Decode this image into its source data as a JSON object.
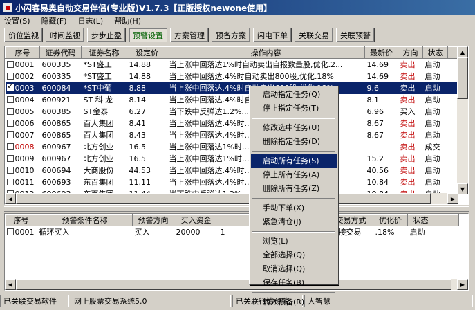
{
  "window": {
    "title": "小闪客易奥自动交易伴侣(专业版)V1.7.3【正版授权newone使用】"
  },
  "menu": [
    {
      "label": "设置(S)"
    },
    {
      "label": "隐藏(F)"
    },
    {
      "label": "日志(L)"
    },
    {
      "label": "帮助(H)"
    }
  ],
  "toolbar": [
    {
      "label": "价位监视"
    },
    {
      "label": "时间监视"
    },
    {
      "label": "步步止盈"
    },
    {
      "label": "预警设置",
      "active": true
    },
    {
      "label": "方案管理"
    },
    {
      "label": "预备方案"
    },
    {
      "label": "闪电下单"
    },
    {
      "label": "关联交易"
    },
    {
      "label": "关联预警"
    }
  ],
  "task_table": {
    "headers": [
      "序号",
      "证券代码",
      "证券名称",
      "设定价",
      "操作内容",
      "最新价",
      "方向",
      "状态"
    ],
    "rows": [
      {
        "no": "0001",
        "code": "600335",
        "name": "*ST盛工",
        "price": "14.88",
        "content": "当上涨中回落达1%时自动卖出自报数量股,优化.2...",
        "latest": "14.69",
        "dir": "卖出",
        "status": "启动",
        "checked": false,
        "selected": false,
        "no_red": false,
        "dir_red": true
      },
      {
        "no": "0002",
        "code": "600335",
        "name": "*ST盛工",
        "price": "14.88",
        "content": "当上涨中回落达.4%时自动卖出800股,优化.18%",
        "latest": "14.69",
        "dir": "卖出",
        "status": "启动",
        "checked": false,
        "selected": false,
        "no_red": false,
        "dir_red": true
      },
      {
        "no": "0003",
        "code": "600084",
        "name": "*ST中葡",
        "price": "8.88",
        "content": "当上涨中回落达.4%时自动卖出600股,优化.18%",
        "latest": "9.6",
        "dir": "卖出",
        "status": "启动",
        "checked": true,
        "selected": true,
        "no_red": false,
        "dir_red": true
      },
      {
        "no": "0004",
        "code": "600921",
        "name": "ST 科 龙",
        "price": "8.14",
        "content": "当上涨中回落达.4%时自动卖出...",
        "latest": "8.1",
        "dir": "卖出",
        "status": "启动",
        "checked": false,
        "selected": false,
        "no_red": false,
        "dir_red": true
      },
      {
        "no": "0005",
        "code": "600385",
        "name": "ST金泰",
        "price": "6.27",
        "content": "当下跌中反弹达1.2%...",
        "latest": "6.96",
        "dir": "买入",
        "status": "启动",
        "checked": false,
        "selected": false,
        "no_red": false,
        "dir_red": false
      },
      {
        "no": "0006",
        "code": "600865",
        "name": "百大集团",
        "price": "8.41",
        "content": "当上涨中回落达.4%时...",
        "latest": "8.67",
        "dir": "卖出",
        "status": "启动",
        "checked": false,
        "selected": false,
        "no_red": false,
        "dir_red": true
      },
      {
        "no": "0007",
        "code": "600865",
        "name": "百大集团",
        "price": "8.43",
        "content": "当上涨中回落达.4%时...",
        "latest": "8.67",
        "dir": "卖出",
        "status": "启动",
        "checked": false,
        "selected": false,
        "no_red": false,
        "dir_red": true
      },
      {
        "no": "0008",
        "code": "600967",
        "name": "北方创业",
        "price": "16.5",
        "content": "当上涨中回落达1%时...",
        "latest": "",
        "dir": "卖出",
        "status": "成交",
        "checked": false,
        "selected": false,
        "no_red": true,
        "dir_red": true
      },
      {
        "no": "0009",
        "code": "600967",
        "name": "北方创业",
        "price": "16.5",
        "content": "当上涨中回落达1%时...",
        "latest": "15.2",
        "dir": "卖出",
        "status": "启动",
        "checked": false,
        "selected": false,
        "no_red": false,
        "dir_red": true
      },
      {
        "no": "0010",
        "code": "600694",
        "name": "大商股份",
        "price": "44.53",
        "content": "当上涨中回落达.4%时...",
        "latest": "40.56",
        "dir": "卖出",
        "status": "启动",
        "checked": false,
        "selected": false,
        "no_red": false,
        "dir_red": true
      },
      {
        "no": "0011",
        "code": "600693",
        "name": "东百集团",
        "price": "11.11",
        "content": "当上涨中回落达.4%时...",
        "latest": "10.84",
        "dir": "卖出",
        "status": "启动",
        "checked": false,
        "selected": false,
        "no_red": false,
        "dir_red": true
      },
      {
        "no": "0012",
        "code": "600693",
        "name": "东百集团",
        "price": "11.44",
        "content": "当下跌中反弹达1.2%...",
        "latest": "10.84",
        "dir": "卖出",
        "status": "启动",
        "checked": false,
        "selected": false,
        "no_red": false,
        "dir_red": true
      }
    ]
  },
  "alert_table": {
    "headers": [
      "序号",
      "预警条件名称",
      "预警方向",
      "买入资金",
      "买入仓",
      "数",
      "交易方式",
      "优化价",
      "状态"
    ],
    "rows": [
      {
        "no": "0001",
        "name": "循环买入",
        "dir": "买入",
        "funds": "20000",
        "pos": "1",
        "count": "",
        "mode": "直接交易",
        ".opt": "",
        "opt": ".18%",
        "status": "启动",
        "checked": false
      }
    ]
  },
  "context_menu": {
    "groups": [
      [
        "启动指定任务(Q)",
        "停止指定任务(T)"
      ],
      [
        "修改选中任务(U)",
        "删除指定任务(D)"
      ],
      [
        "启动所有任务(S)",
        "停止所有任务(A)",
        "删除所有任务(Z)"
      ],
      [
        "手动下单(X)",
        "紧急清仓(J)"
      ],
      [
        "浏览(L)",
        "全部选择(Q)",
        "取消选择(Q)",
        "保存任务(B)"
      ],
      [
        "转入预备(R)"
      ]
    ],
    "highlighted": "启动所有任务(S)"
  },
  "status_bar": {
    "app": "已关联交易软件",
    "system": "网上股票交易系统5.0",
    "quote": "已关联行情预警",
    "quote_app": "大智慧"
  },
  "colors": {
    "title_bg": "#0a246a",
    "selection": "#0a246a",
    "sell": "#c00000"
  }
}
